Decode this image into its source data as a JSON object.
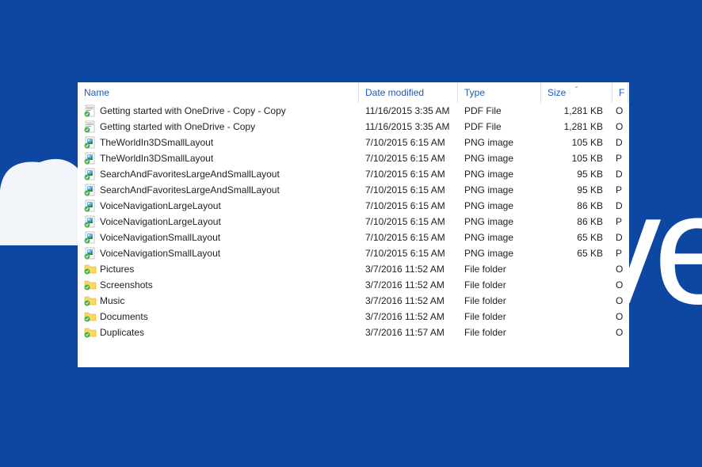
{
  "columns": {
    "name": "Name",
    "date": "Date modified",
    "type": "Type",
    "size": "Size",
    "extra": "F"
  },
  "files": [
    {
      "icon": "pdf",
      "name": "Getting started with OneDrive - Copy - Copy",
      "date": "11/16/2015 3:35 AM",
      "type": "PDF File",
      "size": "1,281 KB",
      "extra": "O"
    },
    {
      "icon": "pdf",
      "name": "Getting started with OneDrive - Copy",
      "date": "11/16/2015 3:35 AM",
      "type": "PDF File",
      "size": "1,281 KB",
      "extra": "O"
    },
    {
      "icon": "png",
      "name": "TheWorldIn3DSmallLayout",
      "date": "7/10/2015 6:15 AM",
      "type": "PNG image",
      "size": "105 KB",
      "extra": "D"
    },
    {
      "icon": "png",
      "name": "TheWorldIn3DSmallLayout",
      "date": "7/10/2015 6:15 AM",
      "type": "PNG image",
      "size": "105 KB",
      "extra": "P"
    },
    {
      "icon": "png",
      "name": "SearchAndFavoritesLargeAndSmallLayout",
      "date": "7/10/2015 6:15 AM",
      "type": "PNG image",
      "size": "95 KB",
      "extra": "D"
    },
    {
      "icon": "png",
      "name": "SearchAndFavoritesLargeAndSmallLayout",
      "date": "7/10/2015 6:15 AM",
      "type": "PNG image",
      "size": "95 KB",
      "extra": "P"
    },
    {
      "icon": "png",
      "name": "VoiceNavigationLargeLayout",
      "date": "7/10/2015 6:15 AM",
      "type": "PNG image",
      "size": "86 KB",
      "extra": "D"
    },
    {
      "icon": "png",
      "name": "VoiceNavigationLargeLayout",
      "date": "7/10/2015 6:15 AM",
      "type": "PNG image",
      "size": "86 KB",
      "extra": "P"
    },
    {
      "icon": "png",
      "name": "VoiceNavigationSmallLayout",
      "date": "7/10/2015 6:15 AM",
      "type": "PNG image",
      "size": "65 KB",
      "extra": "D"
    },
    {
      "icon": "png",
      "name": "VoiceNavigationSmallLayout",
      "date": "7/10/2015 6:15 AM",
      "type": "PNG image",
      "size": "65 KB",
      "extra": "P"
    },
    {
      "icon": "folder",
      "name": "Pictures",
      "date": "3/7/2016 11:52 AM",
      "type": "File folder",
      "size": "",
      "extra": "O"
    },
    {
      "icon": "folder",
      "name": "Screenshots",
      "date": "3/7/2016 11:52 AM",
      "type": "File folder",
      "size": "",
      "extra": "O"
    },
    {
      "icon": "folder",
      "name": "Music",
      "date": "3/7/2016 11:52 AM",
      "type": "File folder",
      "size": "",
      "extra": "O"
    },
    {
      "icon": "folder",
      "name": "Documents",
      "date": "3/7/2016 11:52 AM",
      "type": "File folder",
      "size": "",
      "extra": "O"
    },
    {
      "icon": "folder",
      "name": "Duplicates",
      "date": "3/7/2016 11:57 AM",
      "type": "File folder",
      "size": "",
      "extra": "O"
    }
  ],
  "bgText": "ve"
}
